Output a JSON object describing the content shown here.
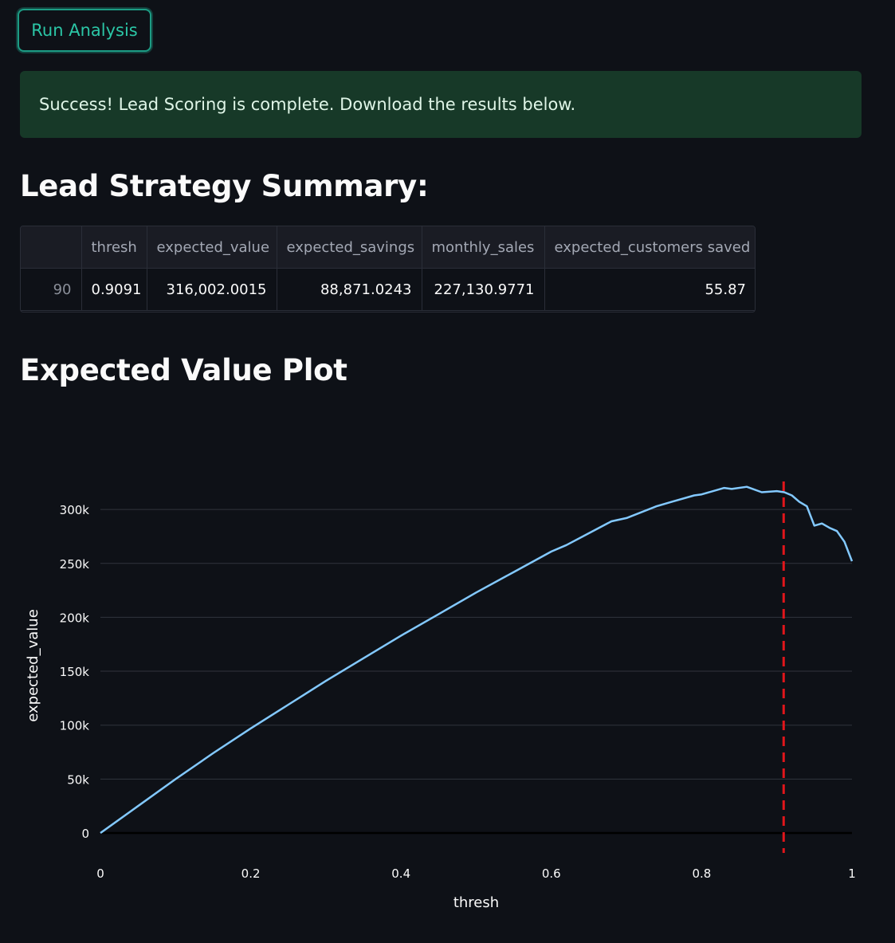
{
  "run_button": {
    "label": "Run Analysis"
  },
  "alert": {
    "message": "Success! Lead Scoring is complete. Download the results below."
  },
  "summary": {
    "heading": "Lead Strategy Summary:",
    "columns": [
      "",
      "thresh",
      "expected_value",
      "expected_savings",
      "monthly_sales",
      "expected_customers saved"
    ],
    "rows": [
      [
        "90",
        "0.9091",
        "316,002.0015",
        "88,871.0243",
        "227,130.9771",
        "55.87"
      ]
    ]
  },
  "plot": {
    "heading": "Expected Value Plot"
  },
  "colors": {
    "background": "#0e1117",
    "accent": "#1c9c84",
    "line": "#83c9ff",
    "threshold_line": "#e0161b",
    "success_bg": "#173928"
  },
  "chart_data": {
    "type": "line",
    "xlabel": "thresh",
    "ylabel": "expected_value",
    "xlim": [
      0,
      1
    ],
    "ylim": [
      0,
      340000
    ],
    "x_ticks": [
      0,
      0.2,
      0.4,
      0.6,
      0.8,
      1
    ],
    "x_tick_labels": [
      "0",
      "0.2",
      "0.4",
      "0.6",
      "0.8",
      "1"
    ],
    "y_ticks": [
      0,
      50000,
      100000,
      150000,
      200000,
      250000,
      300000
    ],
    "y_tick_labels": [
      "0",
      "50k",
      "100k",
      "150k",
      "200k",
      "250k",
      "300k"
    ],
    "grid": true,
    "series": [
      {
        "x": [
          0,
          0.05,
          0.1,
          0.15,
          0.2,
          0.25,
          0.3,
          0.35,
          0.4,
          0.45,
          0.5,
          0.55,
          0.6,
          0.62,
          0.65,
          0.68,
          0.7,
          0.74,
          0.76,
          0.79,
          0.8,
          0.83,
          0.84,
          0.86,
          0.88,
          0.9,
          0.91,
          0.92,
          0.93,
          0.94,
          0.95,
          0.96,
          0.97,
          0.98,
          0.99,
          1.0
        ],
        "y": [
          0,
          25000,
          50000,
          74000,
          97000,
          119000,
          141000,
          162000,
          183000,
          203000,
          223000,
          242000,
          261000,
          267000,
          278000,
          289000,
          292000,
          303000,
          307000,
          313000,
          314000,
          320000,
          319000,
          321000,
          316000,
          317000,
          316000,
          313000,
          307000,
          303000,
          285000,
          287000,
          283000,
          280000,
          270000,
          252000
        ]
      }
    ],
    "threshold_x": 0.9091
  }
}
